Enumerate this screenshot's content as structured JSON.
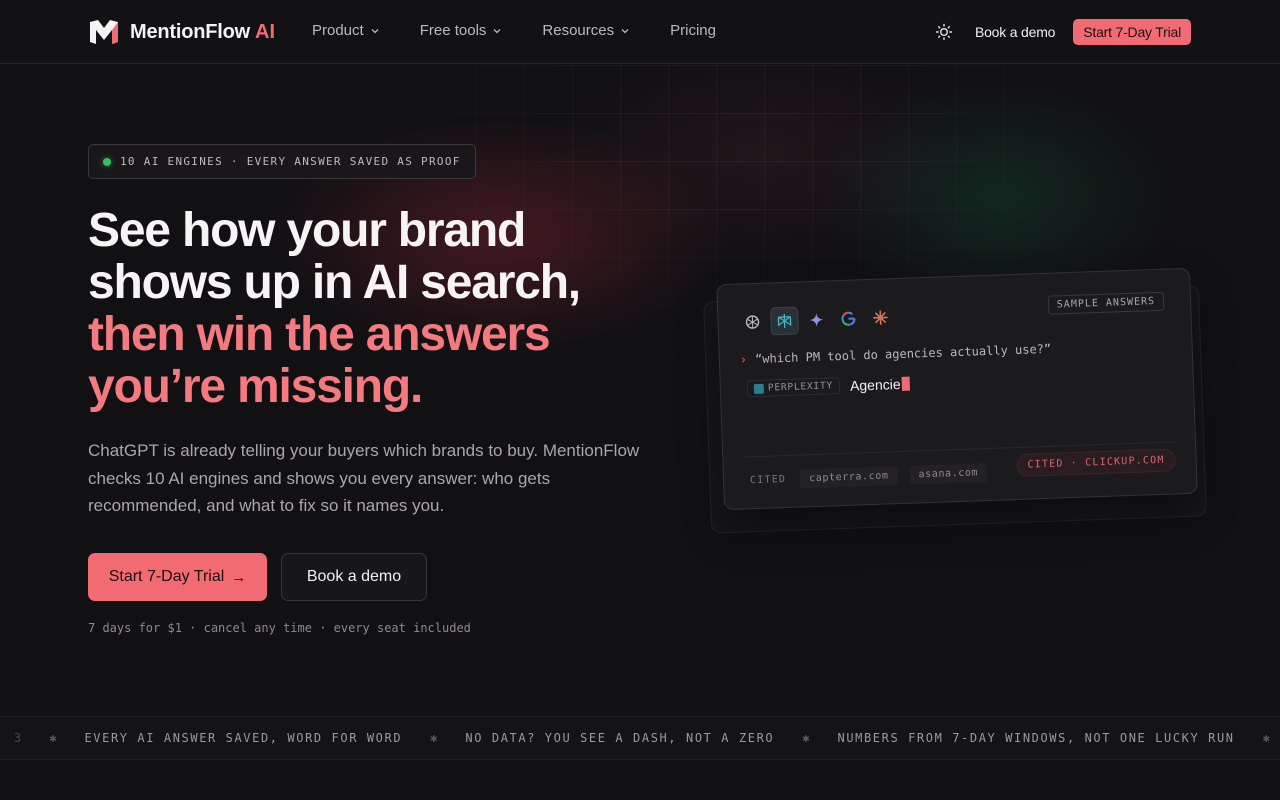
{
  "nav": {
    "brand_name": "MentionFlow",
    "brand_ai": "AI",
    "links": [
      {
        "label": "Product",
        "has_dropdown": true
      },
      {
        "label": "Free tools",
        "has_dropdown": true
      },
      {
        "label": "Resources",
        "has_dropdown": true
      },
      {
        "label": "Pricing",
        "has_dropdown": false
      }
    ],
    "theme_icon": "sun-icon",
    "book_demo": "Book a demo",
    "start_trial": "Start 7-Day Trial"
  },
  "hero": {
    "badge": "10 AI ENGINES · EVERY ANSWER SAVED AS PROOF",
    "headline_line1": "See how your brand",
    "headline_line2": "shows up in AI search,",
    "headline_line3": "then win the answers",
    "headline_line4": "you’re missing.",
    "subcopy": "ChatGPT is already telling your buyers which brands to buy. MentionFlow checks 10 AI engines and shows you every answer: who gets recommended, and what to fix so it names you.",
    "cta_primary": "Start 7-Day Trial",
    "cta_primary_icon": "arrow-right-icon",
    "cta_secondary": "Book a demo",
    "fineprint": "7 days for $1 · cancel any time · every seat included"
  },
  "sample_card": {
    "engines": [
      "chatgpt-icon",
      "perplexity-icon",
      "gemini-icon",
      "google-icon",
      "claude-icon"
    ],
    "active_engine": "perplexity-icon",
    "tag": "SAMPLE ANSWERS",
    "query": "“which PM tool do agencies actually use?”",
    "engine_chip": "PERPLEXITY",
    "answer_text": "Agencie",
    "cited_label": "CITED",
    "cited_sources": [
      "capterra.com",
      "asana.com"
    ],
    "cited_highlight": "CITED · CLICKUP.COM"
  },
  "colors": {
    "accent": "#f26b73",
    "headline_pink": "#f47a80",
    "background": "#111013",
    "status_dot": "#33c15a"
  },
  "ticker": {
    "leading_fragment": "3",
    "items": [
      "EVERY AI ANSWER SAVED, WORD FOR WORD",
      "NO DATA? YOU SEE A DASH, NOT A ZERO",
      "NUMBERS FROM 7-DAY WINDOWS, NOT ONE LUCKY RUN"
    ]
  }
}
